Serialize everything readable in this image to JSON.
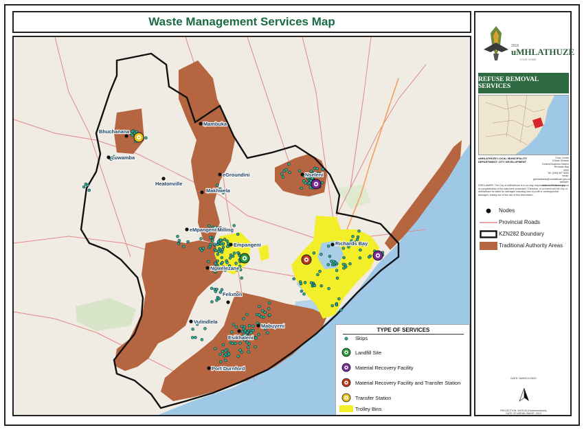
{
  "title": "Waste Management Services Map",
  "side": {
    "logo_name": "uMHLATHUZE",
    "logo_year": "2016",
    "logo_tag": "YOUR HOME",
    "banner": "REFUSE REMOVAL SERVICES",
    "muni_lines": [
      "uMHLATHUZE LOCAL MUNICIPALITY",
      "DEPARTMENT: CITY DEVELOPMENT"
    ],
    "contact_lines": [
      "Civic Centre",
      "5 Mark Strasse",
      "Central Business District",
      "Richards Bay",
      "3900",
      "Tel: (035) 907 5400",
      "email: gisreadiness@umhlathuze.gov.za",
      "website: www.umhlathuze.gov.za"
    ],
    "disclaimer": "DISCLAIMER: The City of uMhlathuze is in no way responsible for the accuracy or completeness of the data here presented. Therefore, in no event will the City of uMhlathuze be liable for damages including loss of profit or consequential damages, arising out of the use of this information.",
    "legend": [
      {
        "label": "Nodes",
        "symbol": "node"
      },
      {
        "label": "Provincial Roads",
        "symbol": "road"
      },
      {
        "label": "KZN282 Boundary",
        "symbol": "boundary"
      },
      {
        "label": "Traditional Authority Areas",
        "symbol": "ta"
      }
    ],
    "date": "DATE: MARCH 2020",
    "projection": "PROJECTION: WGS 84 (Hartebeesthoek)",
    "aerial": "DATE OF AERIAL IMAGE: 2013"
  },
  "types": {
    "title": "TYPE OF SERVICES",
    "items": [
      {
        "label": "Skips",
        "symbol": "skip"
      },
      {
        "label": "Landfill Site",
        "symbol": "landfill"
      },
      {
        "label": "Material Recovery Facility",
        "symbol": "mrf"
      },
      {
        "label": "Material Recovery Facility and Transfer Station",
        "symbol": "mrf_ts"
      },
      {
        "label": "Transfer Station",
        "symbol": "ts"
      },
      {
        "label": "Trolley Bins",
        "symbol": "trolley"
      }
    ]
  },
  "places": [
    {
      "name": "Bhuchanana"
    },
    {
      "name": "Luwamba"
    },
    {
      "name": "Mambuka"
    },
    {
      "name": "Heatonville"
    },
    {
      "name": "eGroundini"
    },
    {
      "name": "Makhwela"
    },
    {
      "name": "Nseleni"
    },
    {
      "name": "eMpangeni Milling"
    },
    {
      "name": "Empangeni"
    },
    {
      "name": "Ngwelezane"
    },
    {
      "name": "Richards Bay"
    },
    {
      "name": "Felixton"
    },
    {
      "name": "Vulindlela"
    },
    {
      "name": "Mabuyeni"
    },
    {
      "name": "Esikhaleni"
    },
    {
      "name": "Port Durnford"
    }
  ],
  "colors": {
    "title": "#1a6b44",
    "banner": "#2e6b43",
    "traditional_authority": "#b5653f",
    "trolley_bins": "#f2ee2a",
    "skip": "#2bb08a",
    "landfill": "#2a9a3a",
    "mrf": "#7a2a9a",
    "mrf_ts": "#c03a1a",
    "transfer_station": "#e6c21a",
    "sea": "#9fc8e6",
    "boundary": "#111111"
  }
}
